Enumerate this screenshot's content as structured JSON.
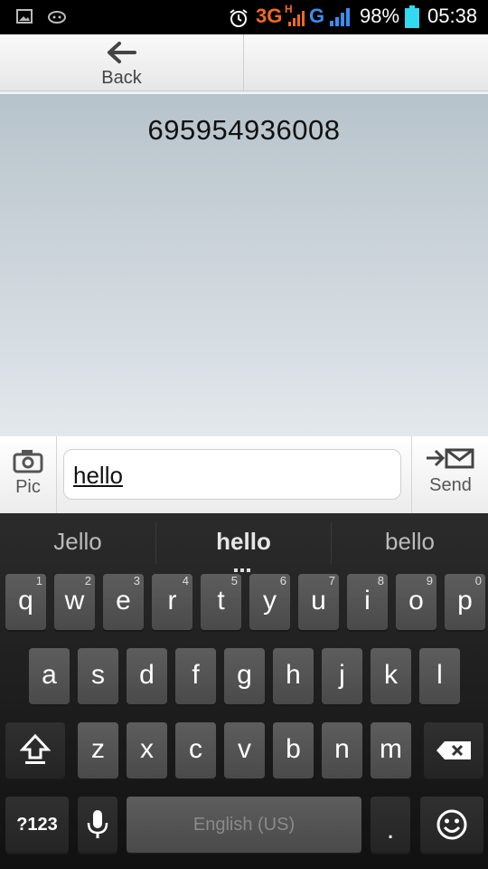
{
  "status_bar": {
    "net_3g": "3G",
    "net_h": "H",
    "net_g": "G",
    "battery": "98%",
    "time": "05:38"
  },
  "header": {
    "back_label": "Back"
  },
  "conversation": {
    "phone_number": "695954936008"
  },
  "compose": {
    "pic_label": "Pic",
    "message_value": "hello",
    "send_label": "Send"
  },
  "keyboard": {
    "suggestions": [
      "Jello",
      "hello",
      "bello"
    ],
    "row1": [
      {
        "ch": "q",
        "hint": "1"
      },
      {
        "ch": "w",
        "hint": "2"
      },
      {
        "ch": "e",
        "hint": "3"
      },
      {
        "ch": "r",
        "hint": "4"
      },
      {
        "ch": "t",
        "hint": "5"
      },
      {
        "ch": "y",
        "hint": "6"
      },
      {
        "ch": "u",
        "hint": "7"
      },
      {
        "ch": "i",
        "hint": "8"
      },
      {
        "ch": "o",
        "hint": "9"
      },
      {
        "ch": "p",
        "hint": "0"
      }
    ],
    "row2": [
      "a",
      "s",
      "d",
      "f",
      "g",
      "h",
      "j",
      "k",
      "l"
    ],
    "row3": [
      "z",
      "x",
      "c",
      "v",
      "b",
      "n",
      "m"
    ],
    "symbols_label": "?123",
    "space_label": "English (US)",
    "period_label": "."
  }
}
